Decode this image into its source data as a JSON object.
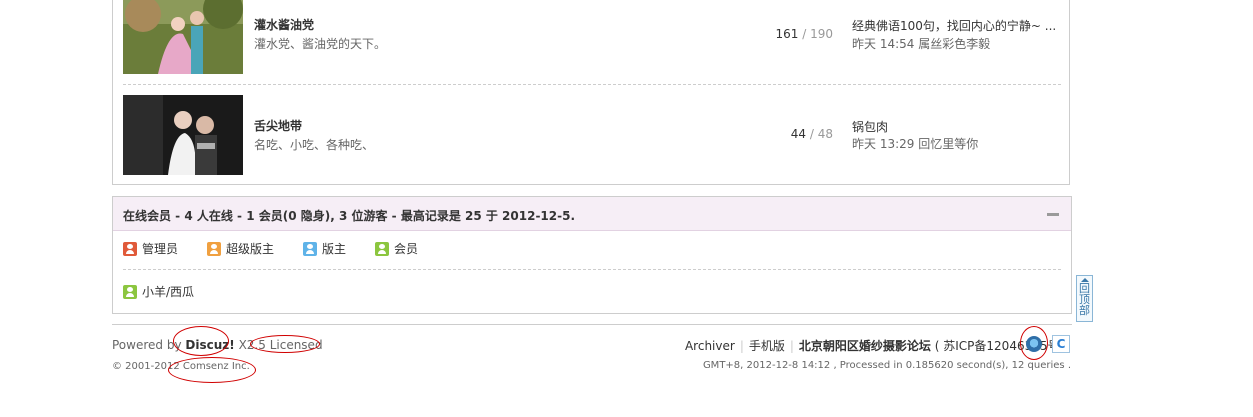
{
  "forums": [
    {
      "name": "灌水酱油党",
      "description": "灌水党、酱油党的天下。",
      "threads": "161",
      "separator": "/",
      "posts": "190",
      "last_post_title": "经典佛语100句，找回内心的宁静~ ...",
      "last_post_meta": "昨天 14:54 属丝彩色李毅"
    },
    {
      "name": "舌尖地带",
      "description": "名吃、小吃、各种吃、",
      "threads": "44",
      "separator": "/",
      "posts": "48",
      "last_post_title": "锅包肉",
      "last_post_meta": "昨天 13:29 回忆里等你"
    }
  ],
  "online": {
    "title": "在线会员 - 4 人在线 - 1 会员(0 隐身), 3 位游客 - 最高记录是 25 于 2012-12-5.",
    "legend": [
      {
        "label": "管理员",
        "icon": "admin-user-icon",
        "color": "#e05a3a"
      },
      {
        "label": "超级版主",
        "icon": "super-moderator-user-icon",
        "color": "#f0a040"
      },
      {
        "label": "版主",
        "icon": "moderator-user-icon",
        "color": "#5fb3e8"
      },
      {
        "label": "会员",
        "icon": "member-user-icon",
        "color": "#8cc63f"
      }
    ],
    "members": [
      {
        "name": "小羊/西瓜",
        "icon": "member-user-icon"
      }
    ]
  },
  "back_to_top": "回顶部",
  "footer": {
    "powered_prefix": "Powered by",
    "brand": "Discuz!",
    "version": "X2.5",
    "licensed": "Licensed",
    "copyright": "© 2001-2012 Comsenz Inc.",
    "links": {
      "archiver": "Archiver",
      "mobile": "手机版",
      "site_name": "北京朝阳区婚纱摄影论坛",
      "icp": "( 苏ICP备12046325号 )"
    },
    "gmt": "GMT+8, 2012-12-8 14:12 , Processed in 0.185620 second(s), 12 queries ."
  },
  "colors": {
    "online_header_bg": "#f6eef6",
    "annotation_red": "#d00000",
    "border": "#cdcdcd"
  }
}
